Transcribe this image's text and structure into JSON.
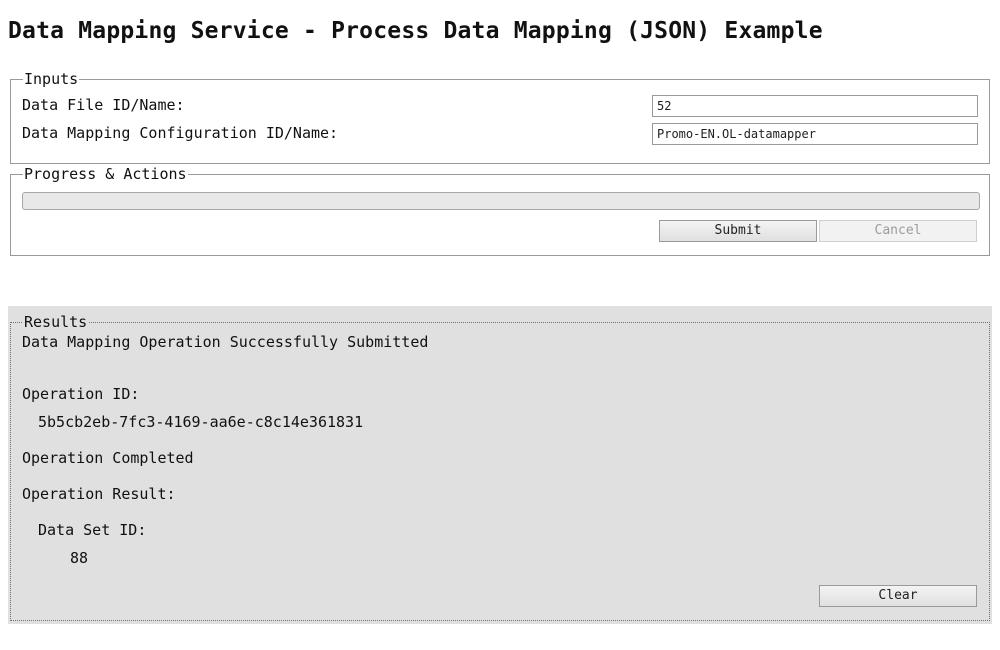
{
  "page": {
    "title": "Data Mapping Service - Process Data Mapping (JSON) Example"
  },
  "inputs": {
    "legend": "Inputs",
    "data_file_label": "Data File ID/Name:",
    "data_file_value": "52",
    "config_label": "Data Mapping Configuration ID/Name:",
    "config_value": "Promo-EN.OL-datamapper"
  },
  "progress": {
    "legend": "Progress & Actions",
    "percent": 0,
    "submit_label": "Submit",
    "cancel_label": "Cancel",
    "cancel_enabled": false
  },
  "results": {
    "legend": "Results",
    "status_message": "Data Mapping Operation Successfully Submitted",
    "operation_id_label": "Operation ID:",
    "operation_id_value": "5b5cb2eb-7fc3-4169-aa6e-c8c14e361831",
    "completion_message": "Operation Completed",
    "operation_result_label": "Operation Result:",
    "data_set_id_label": "Data Set ID:",
    "data_set_id_value": "88",
    "clear_label": "Clear"
  }
}
